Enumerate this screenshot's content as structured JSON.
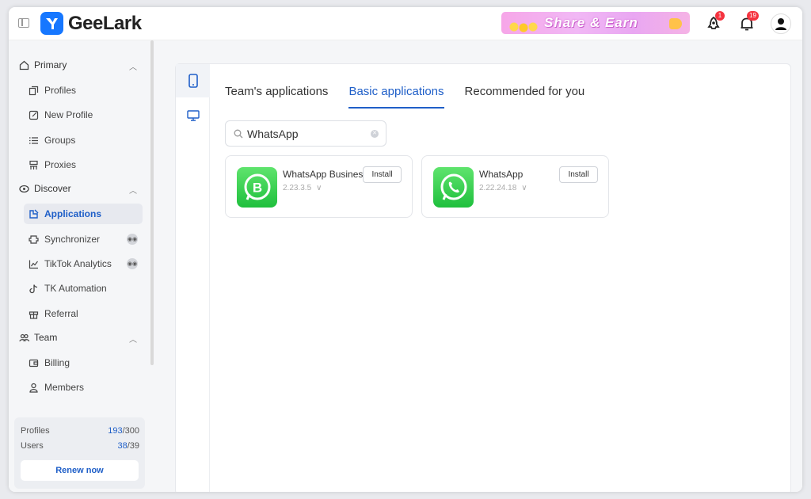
{
  "app": {
    "brand": "GeeLark"
  },
  "header": {
    "banner_text": "Share & Earn",
    "notifications": [
      {
        "icon": "rocket-icon",
        "badge": "1"
      },
      {
        "icon": "bell-icon",
        "badge": "19"
      }
    ],
    "avatar_icon": "user-icon"
  },
  "sidebar": {
    "sections": [
      {
        "label": "Primary",
        "icon": "home-icon",
        "items": [
          {
            "label": "Profiles",
            "icon": "profiles-icon"
          },
          {
            "label": "New Profile",
            "icon": "edit-icon"
          },
          {
            "label": "Groups",
            "icon": "list-icon"
          },
          {
            "label": "Proxies",
            "icon": "proxy-icon"
          }
        ]
      },
      {
        "label": "Discover",
        "icon": "discover-icon",
        "items": [
          {
            "label": "Applications",
            "icon": "applications-icon",
            "active": true
          },
          {
            "label": "Synchronizer",
            "icon": "sync-icon",
            "beta": true
          },
          {
            "label": "TikTok Analytics",
            "icon": "chart-icon",
            "beta": true
          },
          {
            "label": "TK Automation",
            "icon": "tiktok-icon"
          },
          {
            "label": "Referral",
            "icon": "gift-icon"
          }
        ]
      },
      {
        "label": "Team",
        "icon": "team-icon",
        "items": [
          {
            "label": "Billing",
            "icon": "wallet-icon"
          },
          {
            "label": "Members",
            "icon": "members-icon"
          }
        ]
      }
    ],
    "quota": {
      "profiles_label": "Profiles",
      "profiles_used": "193",
      "profiles_total": "/300",
      "users_label": "Users",
      "users_used": "38",
      "users_total": "/39",
      "renew_label": "Renew now"
    }
  },
  "main": {
    "device_tabs": [
      {
        "icon": "phone-icon",
        "active": true
      },
      {
        "icon": "desktop-icon"
      }
    ],
    "tabs": [
      {
        "label": "Team's applications"
      },
      {
        "label": "Basic applications",
        "active": true
      },
      {
        "label": "Recommended for you"
      }
    ],
    "search": {
      "value": "WhatsApp",
      "placeholder": "Search"
    },
    "apps": [
      {
        "name": "WhatsApp Business",
        "version": "2.23.3.5",
        "action": "Install"
      },
      {
        "name": "WhatsApp",
        "version": "2.22.24.18",
        "action": "Install"
      }
    ]
  },
  "colors": {
    "accent": "#1f5fc8",
    "brand": "#1677ff",
    "whatsapp": "#25d366",
    "badge": "#f5333f"
  }
}
